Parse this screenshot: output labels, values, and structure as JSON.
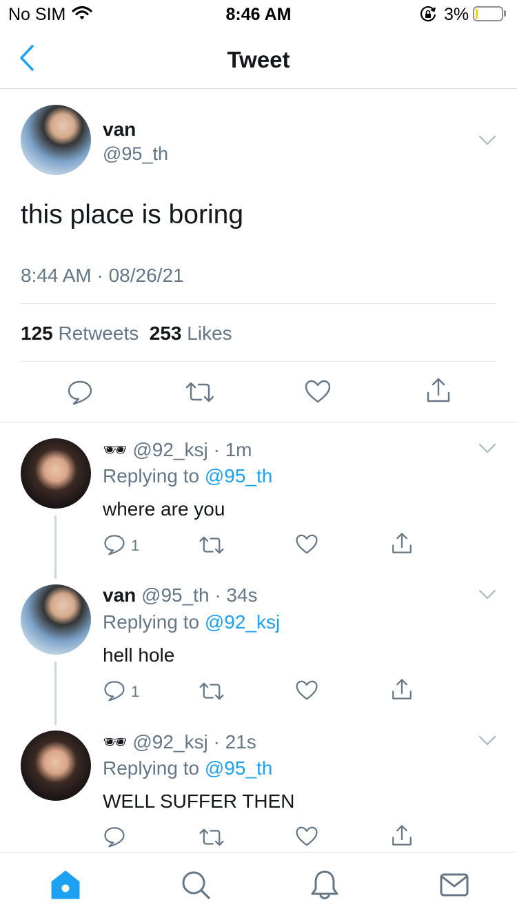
{
  "status_bar": {
    "carrier": "No SIM",
    "time": "8:46 AM",
    "battery": "3%",
    "battery_level": 0.03,
    "icons": [
      "wifi-icon",
      "orientation-lock-icon",
      "battery-icon"
    ]
  },
  "nav": {
    "title": "Tweet",
    "back_icon": "chevron-left-icon"
  },
  "main_tweet": {
    "name": "van",
    "handle": "@95_th",
    "text": "this place is boring",
    "timestamp": "8:44 AM · 08/26/21",
    "retweets": "125",
    "retweets_label": "Retweets",
    "likes": "253",
    "likes_label": "Likes"
  },
  "replies": [
    {
      "name": "🕶",
      "handle": "@92_ksj",
      "time": "· 1m",
      "replying_label": "Replying to",
      "replying_to": "@95_th",
      "text": "where are you",
      "reply_count": "1"
    },
    {
      "name": "van",
      "handle": "@95_th",
      "time": "· 34s",
      "replying_label": "Replying to",
      "replying_to": "@92_ksj",
      "text": "hell hole",
      "reply_count": "1"
    },
    {
      "name": "🕶",
      "handle": "@92_ksj",
      "time": "· 21s",
      "replying_label": "Replying to",
      "replying_to": "@95_th",
      "text": "WELL SUFFER THEN",
      "reply_count": ""
    }
  ],
  "tab_bar": {
    "tabs": [
      "home-icon",
      "search-icon",
      "notifications-icon",
      "messages-icon"
    ],
    "active_color": "#1da1f2"
  },
  "colors": {
    "accent": "#1da1f2",
    "muted": "#657786",
    "text": "#14171a"
  }
}
